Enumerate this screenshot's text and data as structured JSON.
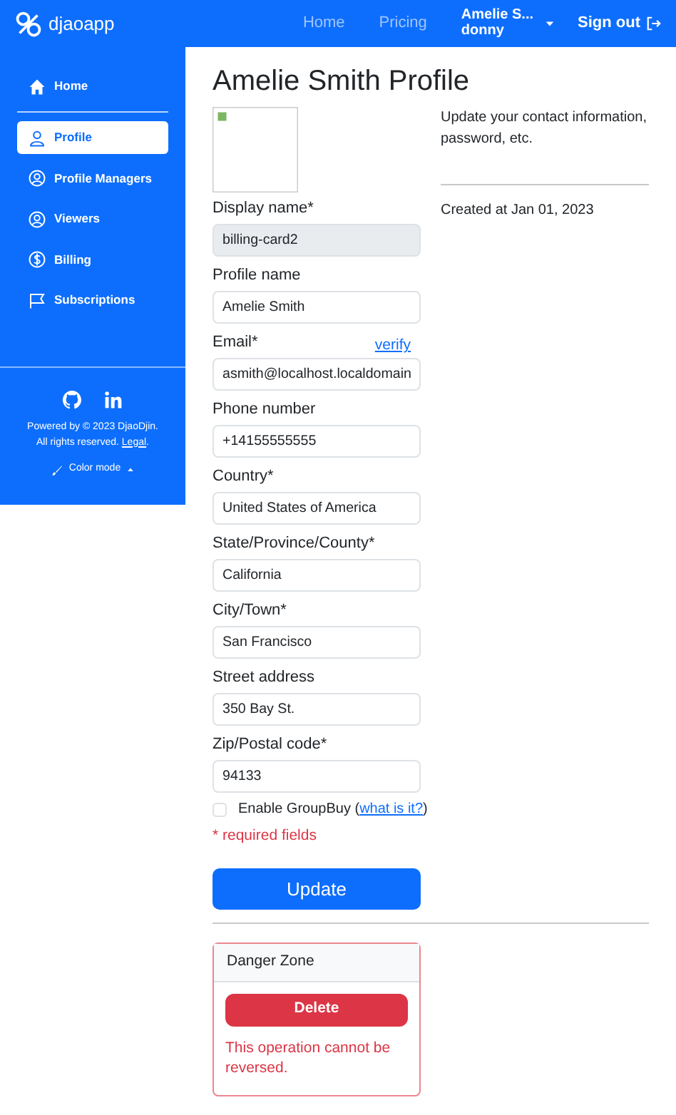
{
  "navbar": {
    "brand": "djaoapp",
    "links": [
      {
        "label": "Home"
      },
      {
        "label": "Pricing"
      }
    ],
    "user": {
      "name": "Amelie S...",
      "username": "donny"
    },
    "sign_out": "Sign out"
  },
  "sidebar": {
    "items": [
      {
        "label": "Home",
        "selected": false
      },
      {
        "label": "Profile",
        "selected": true
      },
      {
        "label": "Profile Managers",
        "selected": false
      },
      {
        "label": "Viewers",
        "selected": false
      },
      {
        "label": "Billing",
        "selected": false
      },
      {
        "label": "Subscriptions",
        "selected": false
      }
    ],
    "footer": {
      "powered": "Powered by © 2023 DjaoDjin.",
      "rights": "All rights reserved.",
      "legal": "Legal",
      "rights_end": ".",
      "color_mode": "Color mode"
    }
  },
  "main": {
    "title": "Amelie Smith Profile",
    "fields": [
      {
        "label": "Display name*",
        "value": "billing-card2",
        "disabled": true
      },
      {
        "label": "Profile name",
        "value": "Amelie Smith",
        "disabled": false
      },
      {
        "label": "Email*",
        "value": "asmith@localhost.localdomain",
        "disabled": false,
        "action": "verify"
      },
      {
        "label": "Phone number",
        "value": "+14155555555",
        "disabled": false
      },
      {
        "label": "Country*",
        "value": "United States of America",
        "disabled": false
      },
      {
        "label": "State/Province/County*",
        "value": "California",
        "disabled": false
      },
      {
        "label": "City/Town*",
        "value": "San Francisco",
        "disabled": false
      },
      {
        "label": "Street address",
        "value": "350 Bay St.",
        "disabled": false
      },
      {
        "label": "Zip/Postal code*",
        "value": "94133",
        "disabled": false
      }
    ],
    "groupbuy": {
      "label": "Enable GroupBuy (",
      "link": "what is it?",
      "label_end": ")",
      "checked": false
    },
    "required_note": "* required fields",
    "update_button": "Update",
    "danger_zone": {
      "title": "Danger Zone",
      "button": "Delete",
      "warning": "This operation cannot be reversed."
    },
    "description": "Update your contact information, password, etc.",
    "created": "Created at Jan 01, 2023"
  }
}
